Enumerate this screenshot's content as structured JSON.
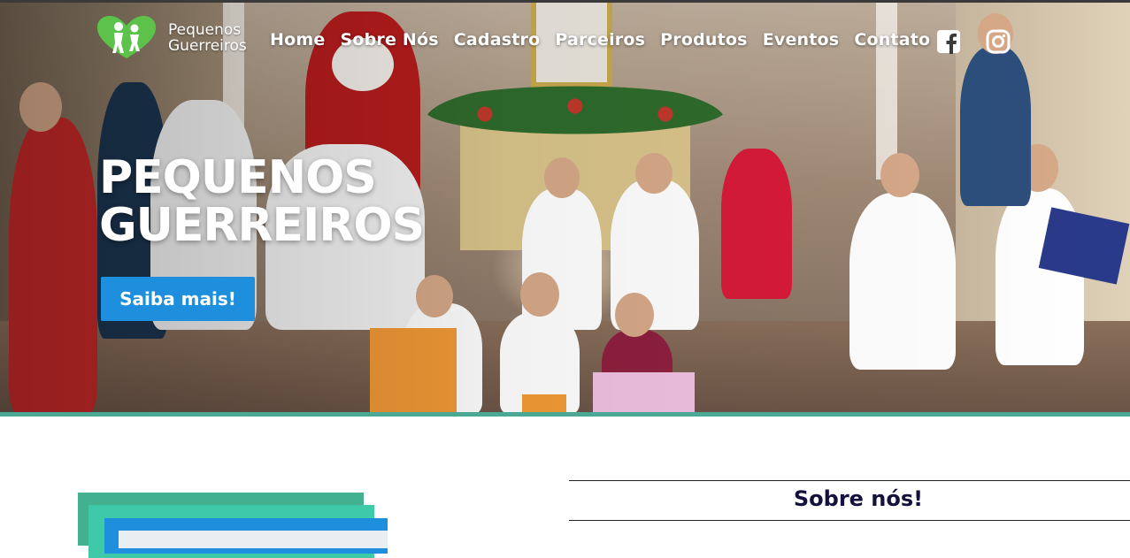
{
  "brand": {
    "name_line1": "Pequenos",
    "name_line2": "Guerreiros",
    "logo_colors": {
      "green": "#5cc24a",
      "white": "#ffffff"
    }
  },
  "nav": {
    "items": [
      {
        "label": "Home"
      },
      {
        "label": "Sobre Nós"
      },
      {
        "label": "Cadastro"
      },
      {
        "label": "Parceiros"
      },
      {
        "label": "Produtos"
      },
      {
        "label": "Eventos"
      },
      {
        "label": "Contato"
      }
    ],
    "social": [
      {
        "icon": "facebook-icon"
      },
      {
        "icon": "instagram-icon"
      }
    ]
  },
  "hero": {
    "title_line1": "PEQUENOS",
    "title_line2": "GUERREIROS",
    "cta_label": "Saiba mais!",
    "accent_color": "#1e8fdc",
    "divider_color": "#4aa894"
  },
  "about": {
    "title": "Sobre nós!",
    "title_color": "#14123d"
  }
}
